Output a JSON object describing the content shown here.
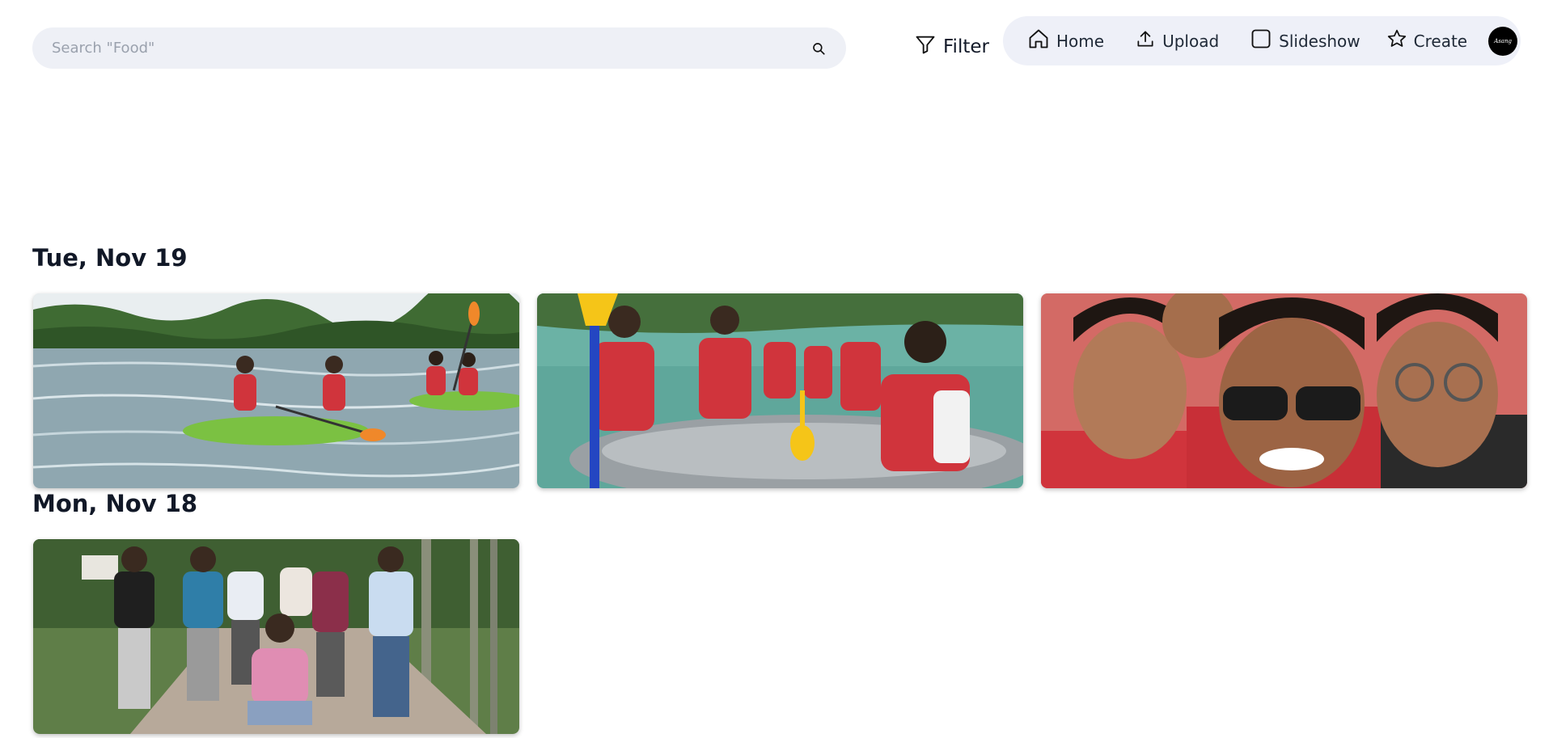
{
  "search": {
    "placeholder": "Search \"Food\"",
    "value": "",
    "icon": "search-icon"
  },
  "toolbar": {
    "filter_label": "Filter"
  },
  "nav": {
    "items": [
      {
        "label": "Home",
        "icon": "home-icon"
      },
      {
        "label": "Upload",
        "icon": "upload-icon"
      },
      {
        "label": "Slideshow",
        "icon": "slideshow-icon"
      },
      {
        "label": "Create",
        "icon": "star-icon"
      }
    ],
    "avatar_text": "Asang"
  },
  "sections": [
    {
      "date": "Tue, Nov 19",
      "photos": [
        {
          "subject": "kayak-river-photo"
        },
        {
          "subject": "rafting-group-photo"
        },
        {
          "subject": "selfie-group-photo"
        }
      ]
    },
    {
      "date": "Mon, Nov 18",
      "photos": [
        {
          "subject": "road-group-photo"
        }
      ]
    }
  ],
  "colors": {
    "search_bg": "#eef0f6",
    "nav_bg": "#eef0f8",
    "text": "#111827",
    "life_jacket": "#d0343c"
  }
}
